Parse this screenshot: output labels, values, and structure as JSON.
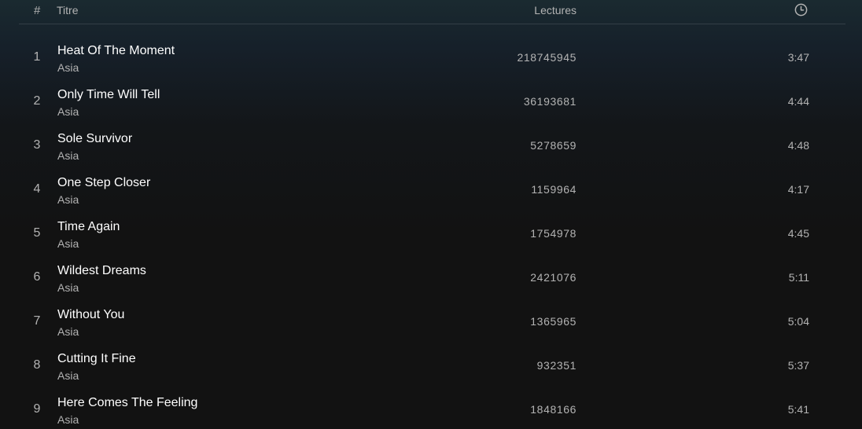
{
  "header": {
    "number": "#",
    "title": "Titre",
    "plays": "Lectures",
    "duration_icon": "clock-icon"
  },
  "tracks": [
    {
      "number": "1",
      "title": "Heat Of The Moment",
      "artist": "Asia",
      "plays": "218745945",
      "duration": "3:47"
    },
    {
      "number": "2",
      "title": "Only Time Will Tell",
      "artist": "Asia",
      "plays": "36193681",
      "duration": "4:44"
    },
    {
      "number": "3",
      "title": "Sole Survivor",
      "artist": "Asia",
      "plays": "5278659",
      "duration": "4:48"
    },
    {
      "number": "4",
      "title": "One Step Closer",
      "artist": "Asia",
      "plays": "1159964",
      "duration": "4:17"
    },
    {
      "number": "5",
      "title": "Time Again",
      "artist": "Asia",
      "plays": "1754978",
      "duration": "4:45"
    },
    {
      "number": "6",
      "title": "Wildest Dreams",
      "artist": "Asia",
      "plays": "2421076",
      "duration": "5:11"
    },
    {
      "number": "7",
      "title": "Without You",
      "artist": "Asia",
      "plays": "1365965",
      "duration": "5:04"
    },
    {
      "number": "8",
      "title": "Cutting It Fine",
      "artist": "Asia",
      "plays": "932351",
      "duration": "5:37"
    },
    {
      "number": "9",
      "title": "Here Comes The Feeling",
      "artist": "Asia",
      "plays": "1848166",
      "duration": "5:41"
    }
  ]
}
